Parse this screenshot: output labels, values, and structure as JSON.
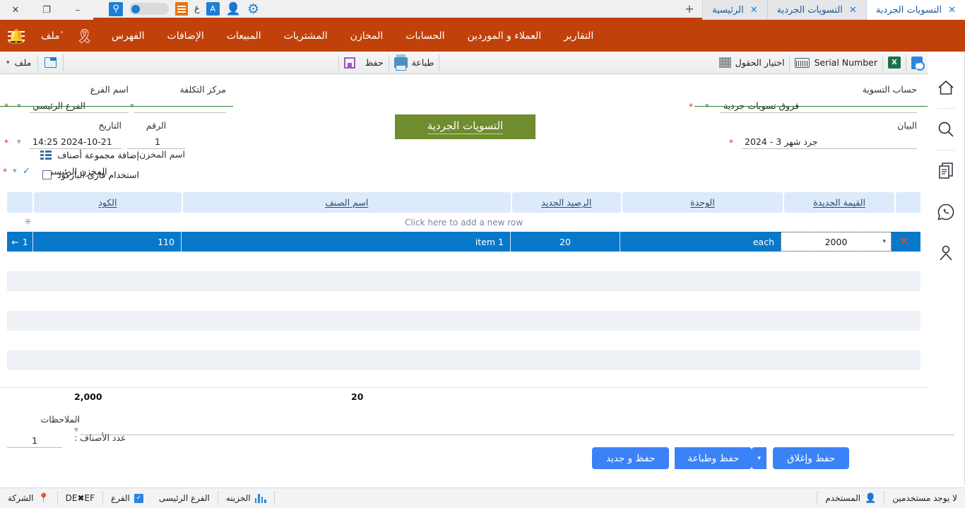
{
  "titlebar": {
    "window_buttons": [
      {
        "name": "close",
        "glyph": "✕"
      },
      {
        "name": "restore",
        "glyph": "❐"
      },
      {
        "name": "minimize",
        "glyph": "–"
      }
    ],
    "quick_icons": [
      {
        "name": "search-icon",
        "glyph": "○"
      },
      {
        "name": "toggle-switch",
        "glyph": ""
      },
      {
        "name": "list-icon",
        "glyph": ""
      },
      {
        "name": "arabic-lang-icon",
        "label": "ع"
      },
      {
        "name": "translate-icon",
        "label": "A"
      },
      {
        "name": "user-icon",
        "glyph": "👤"
      },
      {
        "name": "settings-gear-icon",
        "glyph": "⚙"
      }
    ],
    "new_tab_glyph": "+",
    "tabs": [
      {
        "label": "التسويات الجردية",
        "active": true
      },
      {
        "label": "التسويات الجردية",
        "active": false
      },
      {
        "label": "الرئيسية",
        "active": false
      }
    ],
    "tab_close_glyph": "✕"
  },
  "menubar": {
    "accent_color": "#c1410b",
    "hamburger_name": "main-menu-button",
    "file_label": "ملف",
    "ribbon_label": "الفهرس",
    "items": [
      "الإضافات",
      "المبيعات",
      "المشتريات",
      "المخازن",
      "الحسابات",
      "العملاء و الموردين",
      "التقارير"
    ],
    "bell_name": "notifications-bell-icon"
  },
  "rail": {
    "items": [
      {
        "name": "home-icon",
        "glyph": "⌂"
      },
      {
        "name": "search-icon",
        "glyph": "⌕"
      },
      {
        "name": "documents-icon",
        "glyph": "❐"
      },
      {
        "name": "whatsapp-icon",
        "glyph": "✆"
      },
      {
        "name": "account-icon",
        "glyph": "⚹"
      }
    ]
  },
  "subtoolbar": {
    "file_label": "ملف",
    "file_caret": "▾",
    "new_window_name": "new-window-icon",
    "save_label": "حفظ",
    "print_label": "طباعة",
    "fields_label": "اختيار الحقول",
    "serial_label": "Serial Number",
    "excel_label": "X",
    "export_name": "export-doc-icon"
  },
  "form": {
    "settlement_account": {
      "label": "حساب التسوية",
      "value": "فروق تسويات جردية",
      "required": "*"
    },
    "statement": {
      "label": "البيان",
      "value": "جرد شهر 3 - 2024",
      "required": "*"
    },
    "cost_center": {
      "label": "مركز التكلفة",
      "value": ""
    },
    "branch_name": {
      "label": "اسم الفرع",
      "value": "الفرع الرئيسي",
      "required": "*"
    },
    "number": {
      "label": "الرقم",
      "value": "1"
    },
    "date": {
      "label": "التاريخ",
      "value": "2024-10-21 14:25",
      "required": "*"
    },
    "warehouse": {
      "label": "اسم المخزن",
      "value": "المخزن الرئيسي",
      "required": "*"
    },
    "title_banner": "التسويات الجردية",
    "add_group_label": "إضافة مجموعة أصناف",
    "barcode_label": "استخدام قارئ الباركود",
    "barcode_checked": false
  },
  "grid": {
    "columns": [
      {
        "key": "spacer_r",
        "label": ""
      },
      {
        "key": "code",
        "label": "الكود"
      },
      {
        "key": "item_name",
        "label": "اسم الصنف"
      },
      {
        "key": "new_balance",
        "label": "الرصيد الجديد"
      },
      {
        "key": "unit",
        "label": "الوحدة"
      },
      {
        "key": "new_value",
        "label": "القيمة الجديدة"
      },
      {
        "key": "spacer_l",
        "label": ""
      }
    ],
    "add_row_hint": "Click here to add a new row",
    "new_row_asterisk": "✳",
    "rows": [
      {
        "index": "1",
        "arrow": "←",
        "code": "110",
        "item_name": "item 1",
        "new_balance": "20",
        "unit": "each",
        "new_value": "2000",
        "delete_glyph": "✕",
        "selected": true
      }
    ],
    "totals": {
      "new_value": "2,000",
      "new_balance": "20"
    }
  },
  "footer": {
    "notes_label": "الملاحظات",
    "notes_value": "",
    "items_count_label": "عدد الأصناف :",
    "items_count_value": "1",
    "buttons": [
      {
        "name": "save-and-new-button",
        "label": "حفظ و جديد"
      },
      {
        "name": "save-and-print-button",
        "label": "حفظ وطباعة"
      },
      {
        "name": "save-and-close-button",
        "label": "حفظ وإغلاق"
      }
    ],
    "split_caret": "▾",
    "button_color": "#3b82f6"
  },
  "statusbar": {
    "company_label": "الشركة",
    "company_value": "DE✖EF",
    "branch_label": "الفرع",
    "branch_value": "الفرع الرئيسى",
    "treasury_label": "الخزينه",
    "user_label": "المستخدم",
    "user_value": "لا يوجد مستخدمين",
    "branch_checked": true,
    "check_glyph": "✓"
  }
}
